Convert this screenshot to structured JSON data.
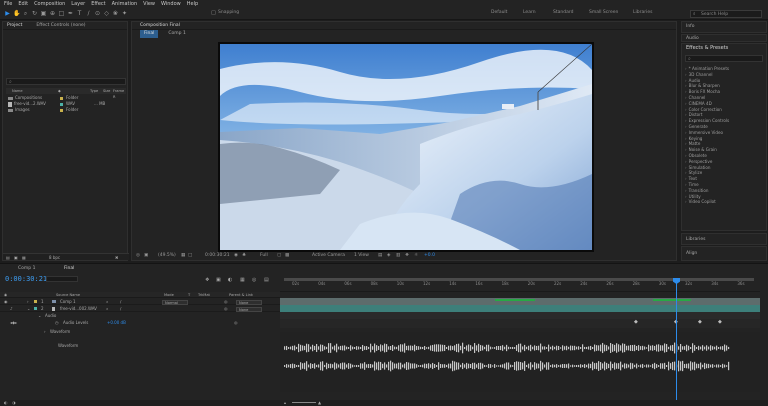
{
  "menu": [
    "File",
    "Edit",
    "Composition",
    "Layer",
    "Effect",
    "Animation",
    "View",
    "Window",
    "Help"
  ],
  "toolbar": {
    "snapping_label": "Snapping",
    "workspaces": [
      "Default",
      "Learn",
      "Standard",
      "Small Screen",
      "Libraries"
    ],
    "search_placeholder": "Search Help"
  },
  "project_panel": {
    "tabs": [
      "Project",
      "Effect Controls (none)"
    ],
    "search_placeholder": "",
    "columns": [
      "Name",
      "",
      "Type",
      "Size",
      "Frame R"
    ],
    "items": [
      {
        "name": "Compositions",
        "label_color": "#c9b24d",
        "type": "Folder",
        "size": ""
      },
      {
        "name": "free-vid...2.WAV",
        "label_color": "#4db2a8",
        "type": "WAV",
        "size": "... MB"
      },
      {
        "name": "Images",
        "label_color": "#c9b24d",
        "type": "Folder",
        "size": ""
      }
    ],
    "footer": {
      "bpc": "8 bpc"
    }
  },
  "composition_panel": {
    "title": "Composition Final",
    "sub_tabs": [
      "Final",
      "Comp 1"
    ],
    "zoom": "(49.5%)",
    "time": "0:00:30:21",
    "resolution": "Full",
    "camera": "Active Camera",
    "views": "1 View",
    "offset": "+0.0"
  },
  "right_panels": {
    "info": "Info",
    "audio": "Audio",
    "effects_title": "Effects & Presets",
    "effects": [
      "* Animation Presets",
      "3D Channel",
      "Audio",
      "Blur & Sharpen",
      "Boris FX Mocha",
      "Channel",
      "CINEMA 4D",
      "Color Correction",
      "Distort",
      "Expression Controls",
      "Generate",
      "Immersive Video",
      "Keying",
      "Matte",
      "Noise & Grain",
      "Obsolete",
      "Perspective",
      "Simulation",
      "Stylize",
      "Text",
      "Time",
      "Transition",
      "Utility",
      "Video Copilot"
    ],
    "libraries": "Libraries",
    "align": "Align"
  },
  "timeline": {
    "tabs": [
      "Comp 1",
      "Final"
    ],
    "timecode": "0:00:30:21",
    "columns": [
      "Source Name",
      "Mode",
      "T",
      "TrkMat",
      "Parent & Link"
    ],
    "layers": [
      {
        "num": "1",
        "name": "Comp 1",
        "mode": "Normal",
        "parent": "None"
      },
      {
        "num": "2",
        "name": "free-vid...002.WAV",
        "mode": "",
        "parent": "None"
      }
    ],
    "audio_label": "Audio",
    "audio_levels_label": "Audio Levels",
    "audio_levels_value": "+0.00 dB",
    "waveform_label": "Waveform",
    "ruler": [
      "02s",
      "04s",
      "06s",
      "08s",
      "10s",
      "12s",
      "14s",
      "16s",
      "18s",
      "20s",
      "22s",
      "24s",
      "26s",
      "28s",
      "30s",
      "32s",
      "34s",
      "36s"
    ],
    "playhead_seconds": 30.9
  },
  "colors": {
    "accent": "#2d8ceb",
    "bar_green": "#27a844",
    "waveform": "#c8c8c8"
  }
}
